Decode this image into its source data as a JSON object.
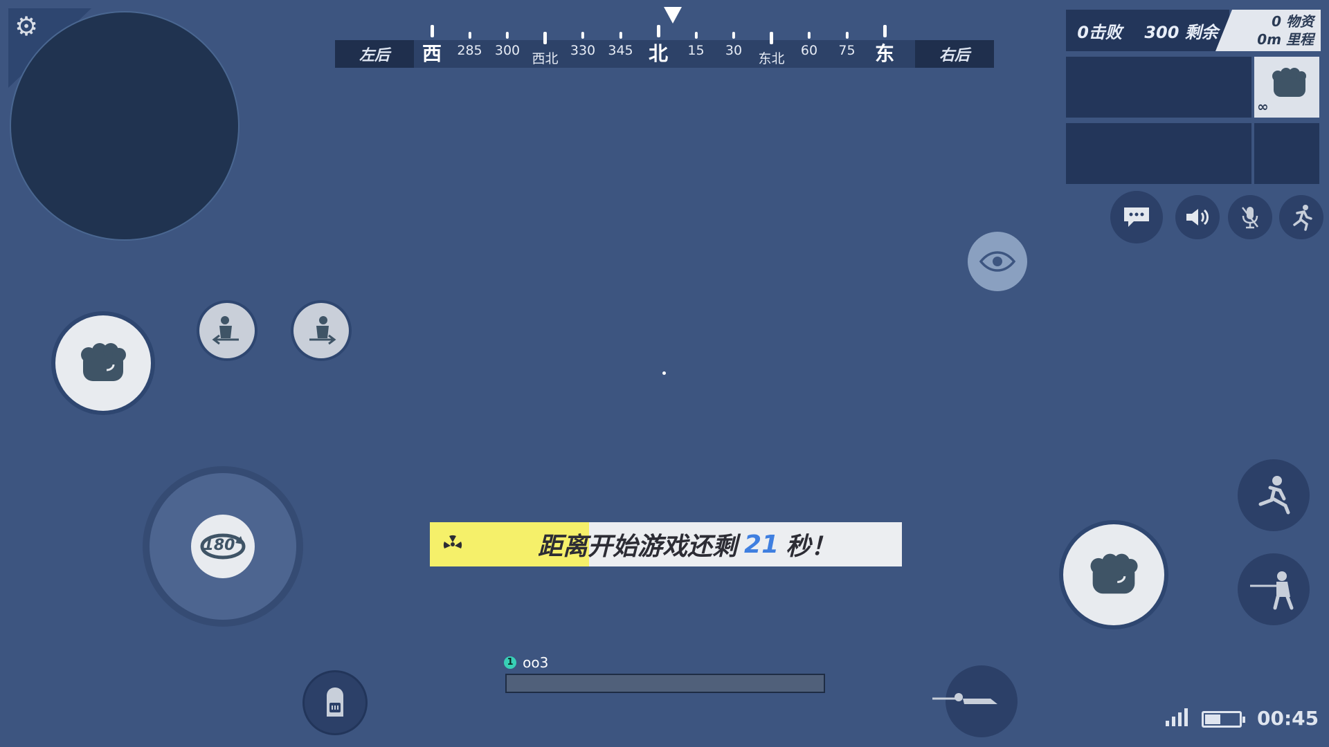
{
  "compass": {
    "left_label": "左后",
    "right_label": "右后",
    "marks": [
      {
        "label": "西",
        "cardinal": true
      },
      {
        "label": "285",
        "cardinal": false
      },
      {
        "label": "300",
        "cardinal": false
      },
      {
        "label": "西北",
        "cardinal": false
      },
      {
        "label": "330",
        "cardinal": false
      },
      {
        "label": "345",
        "cardinal": false
      },
      {
        "label": "北",
        "cardinal": true
      },
      {
        "label": "15",
        "cardinal": false
      },
      {
        "label": "30",
        "cardinal": false
      },
      {
        "label": "东北",
        "cardinal": false
      },
      {
        "label": "60",
        "cardinal": false
      },
      {
        "label": "75",
        "cardinal": false
      },
      {
        "label": "东",
        "cardinal": true
      }
    ]
  },
  "scoreboard": {
    "kills": "0击败",
    "remaining": "300 剩余",
    "supplies": "0 物资",
    "distance": "0m 里程"
  },
  "weapon_slot": {
    "ammo": "∞"
  },
  "banner": {
    "text_before": "距离开始游戏还剩",
    "seconds": "21",
    "text_after": "秒！"
  },
  "buttons": {
    "turn_label": "180°"
  },
  "player": {
    "number": "1",
    "name": "oo3"
  },
  "status": {
    "clock": "00:45",
    "battery_level": 0.45,
    "signal_bars": 4
  },
  "icons": {
    "settings": "gear-icon",
    "chat": "chat-icon",
    "sound": "speaker-icon",
    "mic": "mic-muted-icon",
    "run": "run-icon",
    "eye": "eye-icon",
    "fist": "fist-icon",
    "backpack": "backpack-icon",
    "jump": "jump-icon",
    "crouch": "crouch-icon",
    "prone": "prone-icon",
    "lean_left": "lean-left-icon",
    "lean_right": "lean-right-icon"
  },
  "colors": {
    "background": "#3d5580",
    "banner_yellow": "#f5f06a",
    "banner_number": "#3f7fe0",
    "player_badge": "#38d0b6"
  }
}
